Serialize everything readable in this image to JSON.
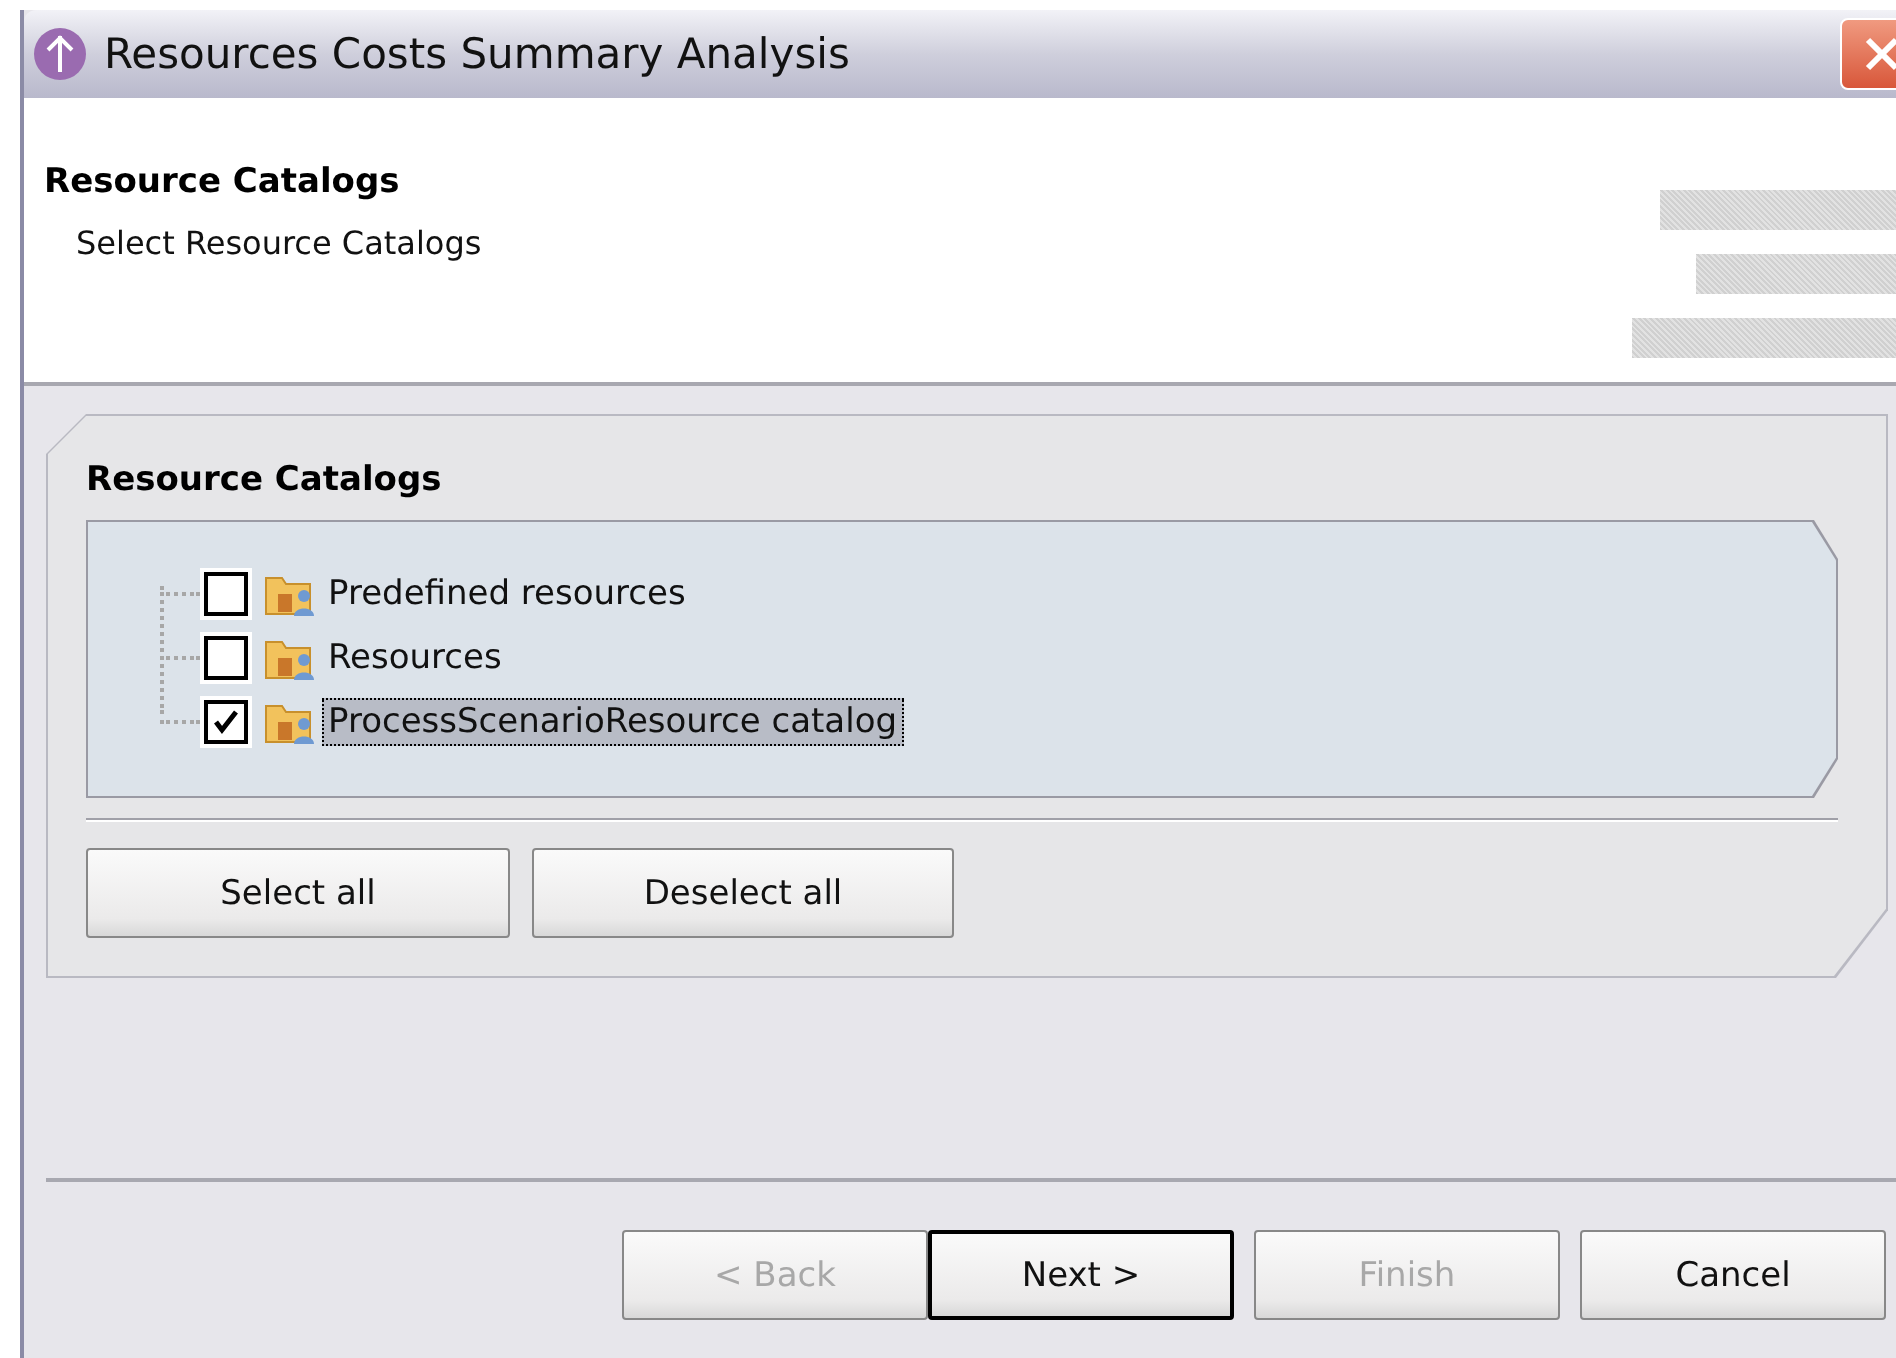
{
  "window": {
    "title": "Resources Costs Summary Analysis"
  },
  "header": {
    "title": "Resource Catalogs",
    "description": "Select Resource Catalogs"
  },
  "group": {
    "title": "Resource Catalogs",
    "items": [
      {
        "label": "Predefined resources",
        "checked": false,
        "selected": false
      },
      {
        "label": "Resources",
        "checked": false,
        "selected": false
      },
      {
        "label": "ProcessScenarioResource catalog",
        "checked": true,
        "selected": true
      }
    ],
    "buttons": [
      {
        "label": "Select all"
      },
      {
        "label": "Deselect all"
      }
    ]
  },
  "footer_buttons": [
    {
      "label": "< Back",
      "disabled": true,
      "default": false
    },
    {
      "label": "Next >",
      "disabled": false,
      "default": true
    },
    {
      "label": "Finish",
      "disabled": true,
      "default": false
    },
    {
      "label": "Cancel",
      "disabled": false,
      "default": false
    }
  ]
}
